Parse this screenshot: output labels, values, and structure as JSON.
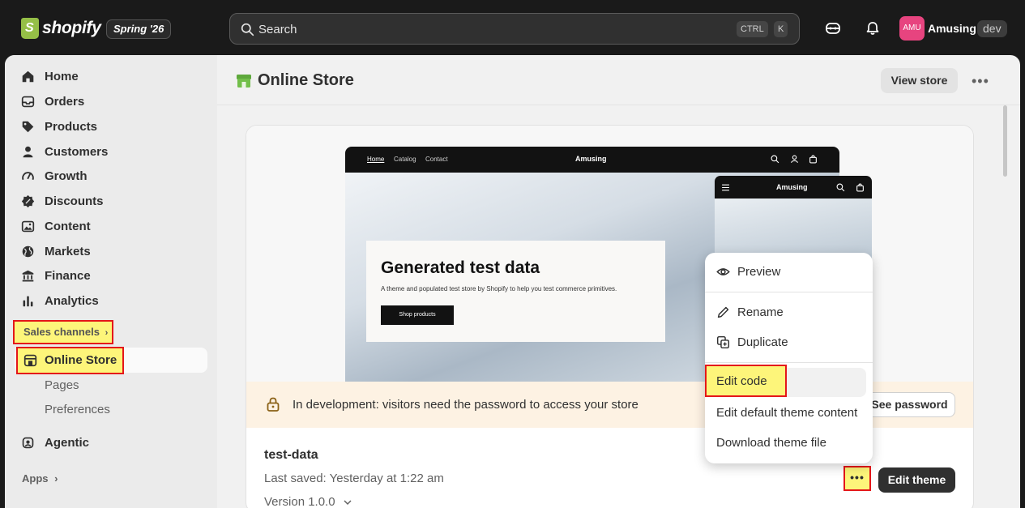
{
  "topbar": {
    "brand": "shopify",
    "edition": "Spring '26",
    "search_placeholder": "Search",
    "shortcut_ctrl": "CTRL",
    "shortcut_k": "K",
    "avatar_initials": "AMU",
    "store_name": "Amusing",
    "store_badge": "dev"
  },
  "sidebar": {
    "items": [
      {
        "label": "Home",
        "icon": "home-icon"
      },
      {
        "label": "Orders",
        "icon": "inbox-icon"
      },
      {
        "label": "Products",
        "icon": "tag-icon"
      },
      {
        "label": "Customers",
        "icon": "person-icon"
      },
      {
        "label": "Growth",
        "icon": "gauge-icon"
      },
      {
        "label": "Discounts",
        "icon": "discount-icon"
      },
      {
        "label": "Content",
        "icon": "image-icon"
      },
      {
        "label": "Markets",
        "icon": "globe-icon"
      },
      {
        "label": "Finance",
        "icon": "bank-icon"
      },
      {
        "label": "Analytics",
        "icon": "chart-icon"
      }
    ],
    "sales_channels_label": "Sales channels",
    "online_store_label": "Online Store",
    "sub_items": [
      "Pages",
      "Preferences"
    ],
    "agentic_label": "Agentic",
    "apps_label": "Apps"
  },
  "header": {
    "title": "Online Store",
    "view_store": "View store"
  },
  "preview": {
    "nav_links": [
      "Home",
      "Catalog",
      "Contact"
    ],
    "brand": "Amusing",
    "hero_title": "Generated test data",
    "hero_subtitle": "A theme and populated test store by Shopify to help you test commerce primitives.",
    "hero_button": "Shop products"
  },
  "banner": {
    "text": "In development: visitors need the password to access your store",
    "button": "See password"
  },
  "theme": {
    "name": "test-data",
    "last_saved": "Last saved: Yesterday at 1:22 am",
    "version": "Version 1.0.0",
    "edit_button": "Edit theme"
  },
  "menu": {
    "preview": "Preview",
    "rename": "Rename",
    "duplicate": "Duplicate",
    "edit_code": "Edit code",
    "edit_default": "Edit default theme content",
    "download": "Download theme file"
  },
  "colors": {
    "highlight": "#fdf57a",
    "highlight_border": "#e4161a",
    "topbar": "#1a1a1a",
    "avatar": "#e7447f"
  }
}
